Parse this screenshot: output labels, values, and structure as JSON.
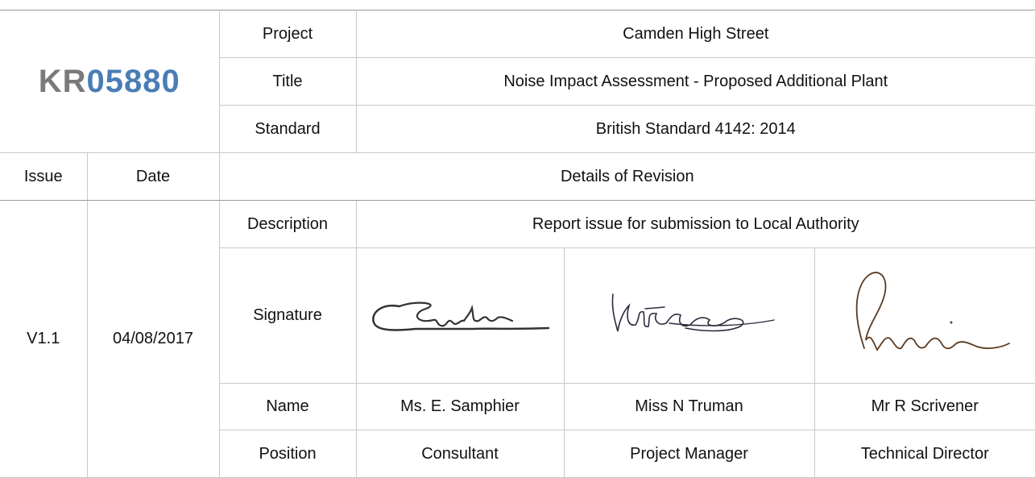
{
  "document": {
    "reference_prefix": "KR",
    "reference_number": "05880"
  },
  "header": {
    "project_label": "Project",
    "project_value": "Camden High Street",
    "title_label": "Title",
    "title_value": "Noise Impact Assessment - Proposed Additional Plant",
    "standard_label": "Standard",
    "standard_value": "British Standard 4142: 2014"
  },
  "revision_header": {
    "issue_label": "Issue",
    "date_label": "Date",
    "details_label": "Details of Revision"
  },
  "revision": {
    "issue": "V1.1",
    "date": "04/08/2017",
    "description_label": "Description",
    "description": "Report issue for submission to Local Authority",
    "signature_label": "Signature",
    "name_label": "Name",
    "position_label": "Position",
    "signatories": [
      {
        "name": "Ms. E. Samphier",
        "position": "Consultant",
        "signature_icon": "handwritten-signature"
      },
      {
        "name": "Miss N Truman",
        "position": "Project Manager",
        "signature_icon": "handwritten-signature"
      },
      {
        "name": "Mr R Scrivener",
        "position": "Technical Director",
        "signature_icon": "handwritten-signature"
      }
    ]
  },
  "colors": {
    "reference_prefix": "#7a7a7a",
    "reference_number": "#4a7db5",
    "label_text": "#8a8a8a",
    "border": "#c8c8c8"
  }
}
